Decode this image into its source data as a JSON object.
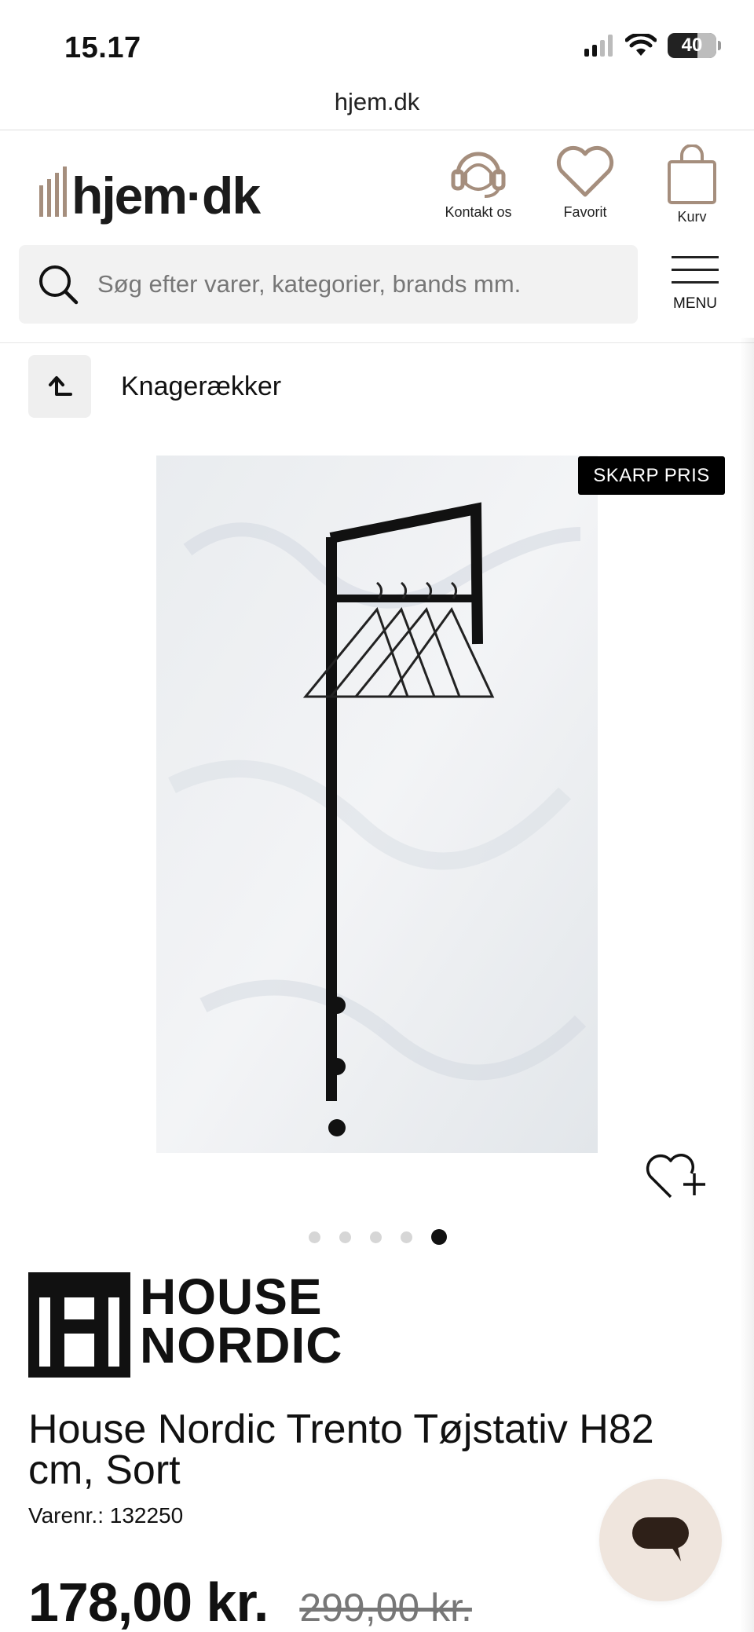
{
  "status_bar": {
    "time": "15.17",
    "battery": "40",
    "battery_level": 0.4
  },
  "browser": {
    "url": "hjem.dk"
  },
  "header": {
    "logo_text": "hjem·dk",
    "actions": [
      {
        "label": "Kontakt os",
        "icon": "headset-icon"
      },
      {
        "label": "Favorit",
        "icon": "heart-icon"
      },
      {
        "label": "Kurv",
        "icon": "shopping-bag-icon"
      }
    ],
    "menu_label": "MENU"
  },
  "search": {
    "placeholder": "Søg efter varer, kategorier, brands mm."
  },
  "breadcrumb": {
    "label": "Knagerækker"
  },
  "product": {
    "badge": "SKARP PRIS",
    "image_count": 5,
    "active_image": 5,
    "brand_line1": "HOUSE",
    "brand_line2": "NORDIC",
    "title": "House Nordic Trento Tøjstativ H82 cm, Sort",
    "sku": "Varenr.: 132250",
    "price": "178,00 kr.",
    "old_price": "299,00 kr."
  },
  "colors": {
    "brand_accent": "#a58e7d",
    "chat_bg": "#efe5dd",
    "badge_bg": "#000000"
  }
}
